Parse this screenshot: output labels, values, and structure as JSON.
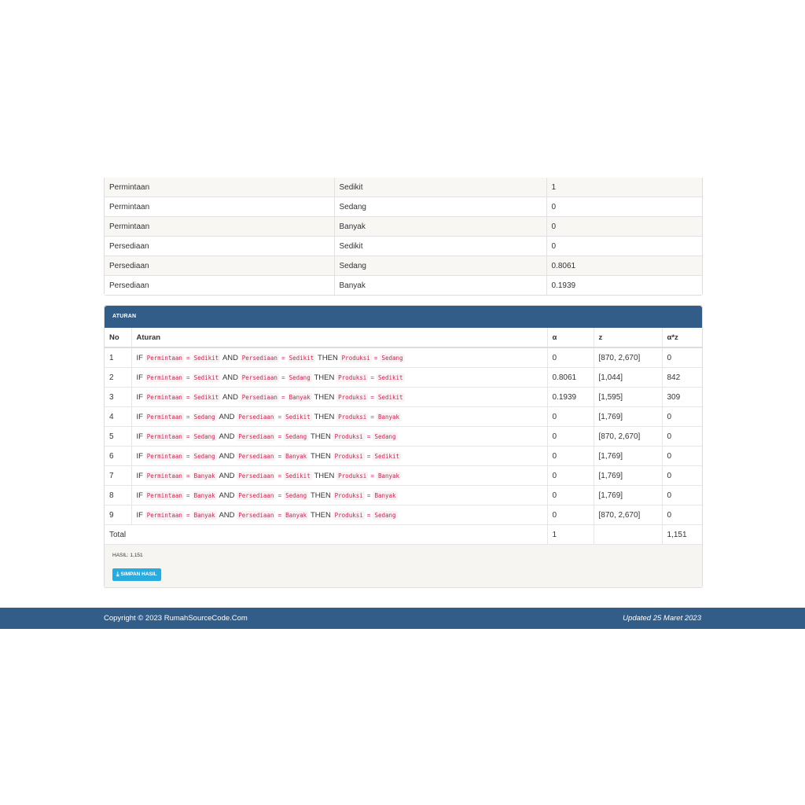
{
  "membership": {
    "rows": [
      {
        "variable": "Permintaan",
        "set": "Sedikit",
        "value": "1"
      },
      {
        "variable": "Permintaan",
        "set": "Sedang",
        "value": "0"
      },
      {
        "variable": "Permintaan",
        "set": "Banyak",
        "value": "0"
      },
      {
        "variable": "Persediaan",
        "set": "Sedikit",
        "value": "0"
      },
      {
        "variable": "Persediaan",
        "set": "Sedang",
        "value": "0.8061"
      },
      {
        "variable": "Persediaan",
        "set": "Banyak",
        "value": "0.1939"
      }
    ]
  },
  "rules": {
    "heading": "ATURAN",
    "columns": {
      "no": "No",
      "aturan": "Aturan",
      "alpha": "α",
      "z": "z",
      "alpha_z": "α*z"
    },
    "keywords": {
      "if": "IF",
      "and": "AND",
      "then": "THEN",
      "eq": "="
    },
    "rows": [
      {
        "no": "1",
        "var1": "Permintaan",
        "val1": "Sedikit",
        "var2": "Persediaan",
        "val2": "Sedikit",
        "var3": "Produksi",
        "val3": "Sedang",
        "alpha": "0",
        "z": "[870, 2,670]",
        "alpha_z": "0"
      },
      {
        "no": "2",
        "var1": "Permintaan",
        "val1": "Sedikit",
        "var2": "Persediaan",
        "val2": "Sedang",
        "var3": "Produksi",
        "val3": "Sedikit",
        "alpha": "0.8061",
        "z": "[1,044]",
        "alpha_z": "842"
      },
      {
        "no": "3",
        "var1": "Permintaan",
        "val1": "Sedikit",
        "var2": "Persediaan",
        "val2": "Banyak",
        "var3": "Produksi",
        "val3": "Sedikit",
        "alpha": "0.1939",
        "z": "[1,595]",
        "alpha_z": "309"
      },
      {
        "no": "4",
        "var1": "Permintaan",
        "val1": "Sedang",
        "var2": "Persediaan",
        "val2": "Sedikit",
        "var3": "Produksi",
        "val3": "Banyak",
        "alpha": "0",
        "z": "[1,769]",
        "alpha_z": "0"
      },
      {
        "no": "5",
        "var1": "Permintaan",
        "val1": "Sedang",
        "var2": "Persediaan",
        "val2": "Sedang",
        "var3": "Produksi",
        "val3": "Sedang",
        "alpha": "0",
        "z": "[870, 2,670]",
        "alpha_z": "0"
      },
      {
        "no": "6",
        "var1": "Permintaan",
        "val1": "Sedang",
        "var2": "Persediaan",
        "val2": "Banyak",
        "var3": "Produksi",
        "val3": "Sedikit",
        "alpha": "0",
        "z": "[1,769]",
        "alpha_z": "0"
      },
      {
        "no": "7",
        "var1": "Permintaan",
        "val1": "Banyak",
        "var2": "Persediaan",
        "val2": "Sedikit",
        "var3": "Produksi",
        "val3": "Banyak",
        "alpha": "0",
        "z": "[1,769]",
        "alpha_z": "0"
      },
      {
        "no": "8",
        "var1": "Permintaan",
        "val1": "Banyak",
        "var2": "Persediaan",
        "val2": "Sedang",
        "var3": "Produksi",
        "val3": "Banyak",
        "alpha": "0",
        "z": "[1,769]",
        "alpha_z": "0"
      },
      {
        "no": "9",
        "var1": "Permintaan",
        "val1": "Banyak",
        "var2": "Persediaan",
        "val2": "Banyak",
        "var3": "Produksi",
        "val3": "Sedang",
        "alpha": "0",
        "z": "[870, 2,670]",
        "alpha_z": "0"
      }
    ],
    "total": {
      "label": "Total",
      "alpha": "1",
      "z": "",
      "alpha_z": "1,151"
    },
    "result_text": "HASIL: 1,151",
    "save_label": "SIMPAN HASIL",
    "save_icon": "download-icon"
  },
  "footer": {
    "copyright": "Copyright © 2023 RumahSourceCode.Com",
    "updated": "Updated 25 Maret 2023",
    "bg_color": "#325d88"
  }
}
